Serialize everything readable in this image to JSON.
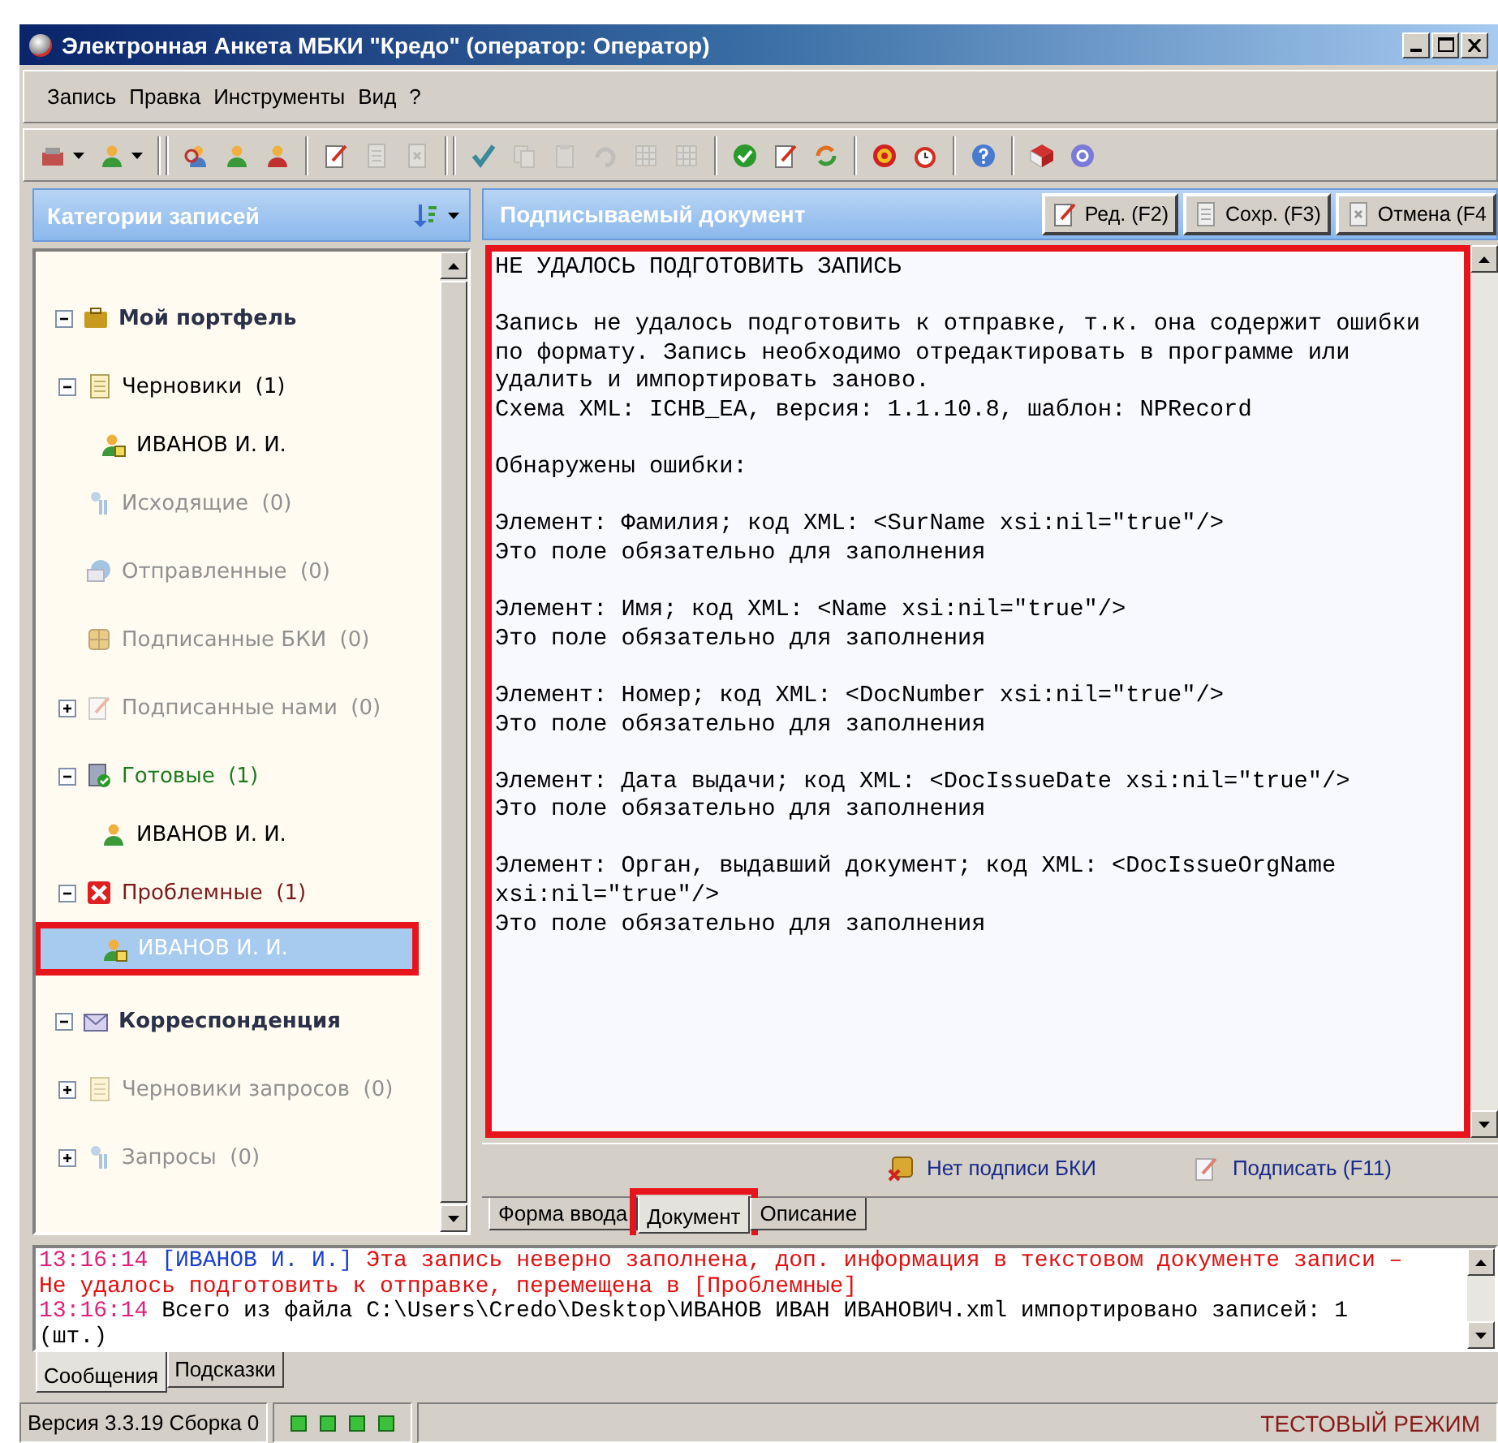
{
  "window": {
    "title": "Электронная Анкета МБКИ \"Кредо\" (оператор: Оператор)"
  },
  "menu": [
    "Запись",
    "Правка",
    "Инструменты",
    "Вид",
    "?"
  ],
  "toolbar": [
    [
      {
        "disabled": false
      },
      {
        "disabled": false
      }
    ],
    [
      {
        "disabled": false
      },
      {
        "disabled": false
      },
      {
        "disabled": false
      }
    ],
    [
      {
        "disabled": false
      },
      {
        "disabled": true
      },
      {
        "disabled": true
      }
    ],
    [
      {
        "disabled": false
      },
      {
        "disabled": true
      },
      {
        "disabled": true
      },
      {
        "disabled": true
      },
      {
        "disabled": true
      },
      {
        "disabled": true
      }
    ],
    [
      {
        "disabled": false
      },
      {
        "disabled": false
      },
      {
        "disabled": false
      }
    ],
    [
      {
        "disabled": false
      },
      {
        "disabled": false
      }
    ],
    [
      {
        "disabled": false
      }
    ],
    [
      {
        "disabled": false
      },
      {
        "disabled": false
      }
    ]
  ],
  "sidebar": {
    "title": "Категории записей",
    "tree": [
      {
        "kind": "group",
        "label": "Мой портфель",
        "expanded": true,
        "children": [
          {
            "kind": "folder",
            "label": "Черновики  (1)",
            "disabled": false,
            "expanded": true,
            "children": [
              {
                "kind": "record",
                "label": "ИВАНОВ И. И.",
                "selected": false,
                "highlighted": false
              }
            ]
          },
          {
            "kind": "folder",
            "label": "Исходящие  (0)",
            "disabled": true
          },
          {
            "kind": "folder",
            "label": "Отправленные  (0)",
            "disabled": true
          },
          {
            "kind": "folder",
            "label": "Подписанные БКИ  (0)",
            "disabled": true
          },
          {
            "kind": "folder",
            "label": "Подписанные нами  (0)",
            "disabled": true,
            "expanded": false
          },
          {
            "kind": "folder",
            "label": "Готовые  (1)",
            "disabled": false,
            "color": "#1e7a1e",
            "expanded": true,
            "children": [
              {
                "kind": "record",
                "label": "ИВАНОВ И. И.",
                "selected": false,
                "highlighted": false
              }
            ]
          },
          {
            "kind": "folder",
            "label": "Проблемные  (1)",
            "disabled": false,
            "color": "#7a1a1a",
            "expanded": true,
            "children": [
              {
                "kind": "record",
                "label": "ИВАНОВ И. И.",
                "selected": true,
                "highlighted": true
              }
            ]
          }
        ]
      },
      {
        "kind": "group",
        "label": "Корреспонденция",
        "expanded": true,
        "children": [
          {
            "kind": "folder",
            "label": "Черновики запросов  (0)",
            "disabled": true,
            "expanded": false
          },
          {
            "kind": "folder",
            "label": "Запросы  (0)",
            "disabled": true,
            "expanded": false
          }
        ]
      }
    ]
  },
  "document": {
    "title": "Подписываемый документ",
    "buttons": [
      "Ред. (F2)",
      "Сохр. (F3)",
      "Отмена (F4"
    ],
    "highlighted": true,
    "paragraphs": [
      [
        "НЕ УДАЛОСЬ ПОДГОТОВИТЬ ЗАПИСЬ"
      ],
      [
        "Запись не удалось подготовить к отправке, т.к. она содержит ошибки",
        "по формату. Запись необходимо отредактировать в программе или",
        "удалить и импортировать заново.",
        "Схема XML: ICHB_EA, версия: 1.1.10.8, шаблон: NPRecord"
      ],
      [
        "Обнаружены ошибки:"
      ],
      [
        "Элемент: Фамилия; код XML: <SurName xsi:nil=\"true\"/>",
        "Это поле обязательно для заполнения"
      ],
      [
        "Элемент: Имя; код XML: <Name xsi:nil=\"true\"/>",
        "Это поле обязательно для заполнения"
      ],
      [
        "Элемент: Номер; код XML: <DocNumber xsi:nil=\"true\"/>",
        "Это поле обязательно для заполнения"
      ],
      [
        "Элемент: Дата выдачи; код XML: <DocIssueDate xsi:nil=\"true\"/>",
        "Это поле обязательно для заполнения"
      ],
      [
        "Элемент: Орган, выдавший документ; код XML: <DocIssueOrgName",
        "xsi:nil=\"true\"/>",
        "Это поле обязательно для заполнения"
      ]
    ],
    "actions": [
      "Нет подписи БКИ",
      "Подписать (F11)"
    ],
    "tabs": [
      {
        "label": "Форма ввода",
        "selected": false,
        "highlighted": false
      },
      {
        "label": "Документ",
        "selected": true,
        "highlighted": true
      },
      {
        "label": "Описание",
        "selected": false,
        "highlighted": false
      }
    ]
  },
  "log": {
    "messages": [
      {
        "kind": "error",
        "time": "13:16:14",
        "source": "[ИВАНОВ И. И.]",
        "text": "Эта запись неверно заполнена, доп. информация в текстовом документе записи –\nНе удалось подготовить к отправке, перемещена в [Проблемные]"
      },
      {
        "kind": "info",
        "time": "13:16:14",
        "text": "Всего из файла C:\\Users\\Credo\\Desktop\\ИВАНОВ ИВАН ИВАНОВИЧ.xml импортировано записей: 1 (шт.)"
      }
    ],
    "tabs": [
      {
        "label": "Сообщения",
        "selected": true
      },
      {
        "label": "Подсказки",
        "selected": false
      }
    ]
  },
  "status_bar": {
    "version": "Версия 3.3.19 Сборка 0",
    "mode": "ТЕСТОВЫЙ РЕЖИМ"
  }
}
